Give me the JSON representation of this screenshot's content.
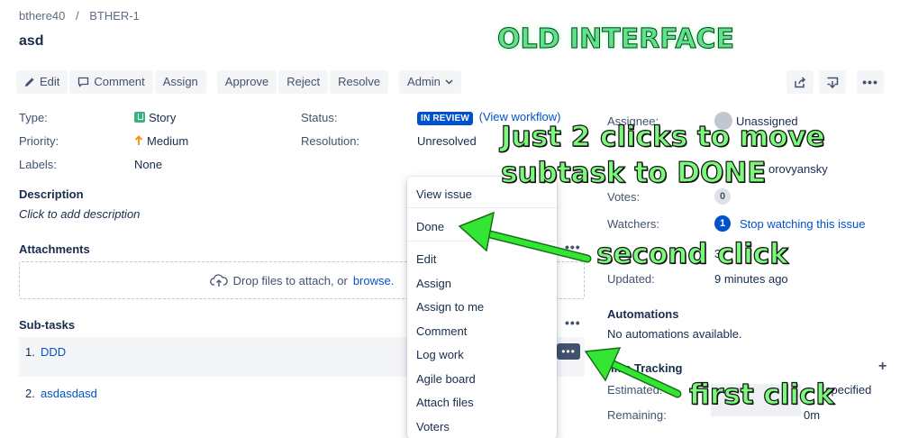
{
  "breadcrumb": {
    "project": "bthere40",
    "issue_key": "BTHER-1"
  },
  "issue": {
    "title": "asd"
  },
  "toolbar": {
    "edit": "Edit",
    "comment": "Comment",
    "assign": "Assign",
    "approve": "Approve",
    "reject": "Reject",
    "resolve": "Resolve",
    "admin": "Admin"
  },
  "details": {
    "type_label": "Type:",
    "type_value": "Story",
    "priority_label": "Priority:",
    "priority_value": "Medium",
    "labels_label": "Labels:",
    "labels_value": "None",
    "status_label": "Status:",
    "status_value": "IN REVIEW",
    "view_workflow": "(View workflow)",
    "resolution_label": "Resolution:",
    "resolution_value": "Unresolved"
  },
  "description": {
    "heading": "Description",
    "placeholder": "Click to add description"
  },
  "attachments": {
    "heading": "Attachments",
    "drop_text": "Drop files to attach, or",
    "browse": "browse."
  },
  "subtasks": {
    "heading": "Sub-tasks",
    "items": [
      {
        "num": "1.",
        "name": "DDD"
      },
      {
        "num": "2.",
        "name": "asdasdasd"
      }
    ]
  },
  "context_menu": {
    "items": [
      "View issue",
      "Done",
      "Edit",
      "Assign",
      "Assign to me",
      "Comment",
      "Log work",
      "Agile board",
      "Attach files",
      "Voters"
    ]
  },
  "people": {
    "assignee_label": "Assignee:",
    "assignee_value": "Unassigned",
    "reporter_partial": "orovyansky",
    "votes_label": "Votes:",
    "votes_count": "0",
    "watchers_label": "Watchers:",
    "watchers_count": "1",
    "stop_watching": "Stop watching this issue",
    "updated_label": "Updated:",
    "updated_value": "9 minutes ago",
    "created_partial": "3"
  },
  "automations": {
    "heading": "Automations",
    "text": "No automations available."
  },
  "time_tracking": {
    "heading": "ime Tracking",
    "estimated_label": "Estimated:",
    "estimated_partial": "specified",
    "remaining_label": "Remaining:",
    "remaining_value": "0m"
  },
  "annotations": {
    "old_interface": "OLD INTERFACE",
    "callout_line1": "Just 2 clicks to move",
    "callout_line2": "subtask to DONE",
    "second_click": "second click",
    "first_click": "first click"
  },
  "colors": {
    "arrow": "#33E633",
    "link": "#0052CC",
    "lozenge": "#0052CC"
  }
}
